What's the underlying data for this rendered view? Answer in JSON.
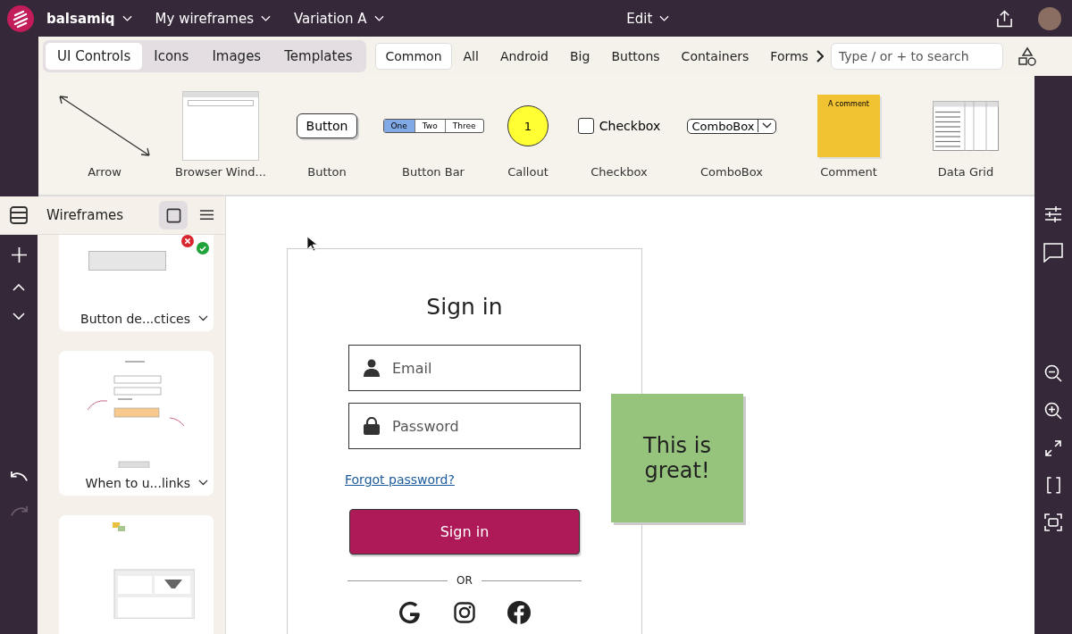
{
  "topbar": {
    "app": "balsamiq",
    "menus": [
      {
        "label": "My wireframes"
      },
      {
        "label": "Variation A"
      }
    ],
    "center_menu": "Edit"
  },
  "library": {
    "groups": [
      {
        "label": "UI Controls",
        "selected": true
      },
      {
        "label": "Icons",
        "selected": false
      },
      {
        "label": "Images",
        "selected": false
      },
      {
        "label": "Templates",
        "selected": false
      }
    ],
    "filters": [
      {
        "label": "Common",
        "selected": true
      },
      {
        "label": "All",
        "selected": false
      },
      {
        "label": "Android",
        "selected": false
      },
      {
        "label": "Big",
        "selected": false
      },
      {
        "label": "Buttons",
        "selected": false
      },
      {
        "label": "Containers",
        "selected": false
      },
      {
        "label": "Forms",
        "selected": false
      }
    ],
    "search": {
      "placeholder": "Type / or + to search"
    },
    "controls": [
      {
        "kind": "arrow",
        "label": "Arrow"
      },
      {
        "kind": "browser",
        "label": "Browser Wind..."
      },
      {
        "kind": "button",
        "label": "Button",
        "text": "Button"
      },
      {
        "kind": "buttonbar",
        "label": "Button Bar",
        "items": [
          {
            "label": "One",
            "selected": true
          },
          {
            "label": "Two",
            "selected": false
          },
          {
            "label": "Three",
            "selected": false
          }
        ]
      },
      {
        "kind": "callout",
        "label": "Callout",
        "text": "1"
      },
      {
        "kind": "checkbox",
        "label": "Checkbox",
        "text": "Checkbox",
        "checked": false
      },
      {
        "kind": "combobox",
        "label": "ComboBox",
        "text": "ComboBox"
      },
      {
        "kind": "comment",
        "label": "Comment",
        "text": "A comment"
      },
      {
        "kind": "datagrid",
        "label": "Data Grid"
      }
    ]
  },
  "sidebar": {
    "title": "Wireframes",
    "views": [
      {
        "kind": "grid",
        "selected": true
      },
      {
        "kind": "list",
        "selected": false
      }
    ],
    "history": [
      {
        "kind": "undo",
        "disabled": false
      },
      {
        "kind": "redo",
        "disabled": true
      }
    ],
    "wireframes": [
      {
        "kind": "blog",
        "title": "Button de...ctices",
        "badges": [
          {
            "kind": "cross",
            "color": "#d8262e"
          },
          {
            "kind": "check",
            "color": "#1fa33a"
          }
        ]
      },
      {
        "kind": "signin",
        "title": "When to u...links"
      },
      {
        "kind": "dashboard"
      }
    ]
  },
  "canvas": {
    "frame": {
      "title": "Sign in",
      "fields": [
        {
          "kind": "person",
          "placeholder": "Email"
        },
        {
          "kind": "lock",
          "placeholder": "Password"
        }
      ],
      "link": "Forgot password?",
      "button": "Sign in",
      "divider": "OR",
      "social": [
        {
          "kind": "google"
        },
        {
          "kind": "instagram"
        },
        {
          "kind": "facebook"
        }
      ]
    },
    "note": {
      "text": "This is great!"
    }
  }
}
